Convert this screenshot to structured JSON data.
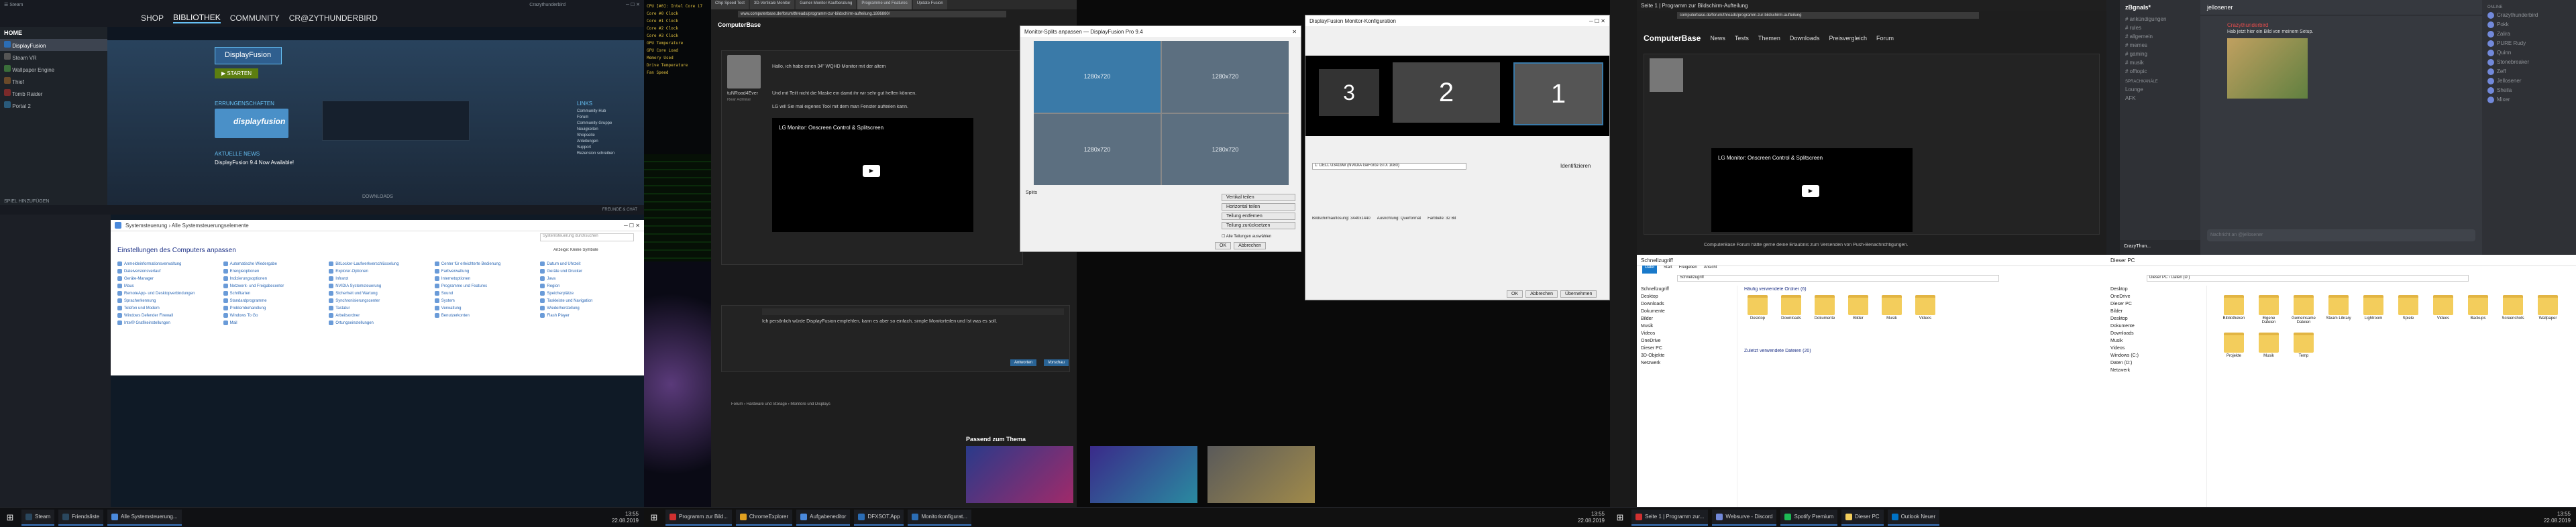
{
  "monitor1": {
    "steam": {
      "nav": [
        "SHOP",
        "BIBLIOTHEK",
        "COMMUNITY",
        "CR@ZYTHUNDERBIRD"
      ],
      "active_nav": "BIBLIOTHEK",
      "user_badge": "Crazythunderbird",
      "sidebar_header": "HOME",
      "sidebar_items": [
        "DisplayFusion",
        "Steam VR",
        "Wallpaper Engine",
        "Thief",
        "Tomb Raider",
        "Portal 2"
      ],
      "game_title": "DisplayFusion",
      "play_button": "▶ STARTEN",
      "achievements_label": "ERRUNGENSCHAFTEN",
      "achievement_banner": "displayfusion",
      "section_latest_news": "AKTUELLE NEWS",
      "news_title": "DisplayFusion 9.4 Now Available!",
      "links_header": "LINKS",
      "links": [
        "Community-Hub",
        "Forum",
        "Community-Gruppe",
        "Neuigkeiten",
        "Shopseite",
        "Anleitungen",
        "Support",
        "Rezension schreiben"
      ],
      "downloads_label": "DOWNLOADS",
      "downloads_status": "Verwalten",
      "friends_header": "FREUNDE & CHAT",
      "add_game": "SPIEL HINZUFÜGEN"
    },
    "control_panel": {
      "address": "Systemsteuerung › Alle Systemsteuerungselemente",
      "search_placeholder": "Systemsteuerung durchsuchen",
      "heading": "Einstellungen des Computers anpassen",
      "view_by": "Anzeige: Kleine Symbole",
      "items": [
        "Anmeldeinformationsverwaltung",
        "Automatische Wiedergabe",
        "BitLocker-Laufwerkverschlüsselung",
        "Center für erleichterte Bedienung",
        "Datum und Uhrzeit",
        "Dateiversionsverlauf",
        "Energieoptionen",
        "Explorer-Optionen",
        "Farbverwaltung",
        "Geräte und Drucker",
        "Geräte-Manager",
        "Indizierungsoptionen",
        "Infrarot",
        "Internetoptionen",
        "Java",
        "Maus",
        "Netzwerk- und Freigabecenter",
        "NVIDIA Systemsteuerung",
        "Programme und Features",
        "Region",
        "RemoteApp- und Desktopverbindungen",
        "Schriftarten",
        "Sicherheit und Wartung",
        "Sound",
        "Speicherplätze",
        "Spracherkennung",
        "Standardprogramme",
        "Synchronisierungscenter",
        "System",
        "Taskleiste und Navigation",
        "Telefon und Modem",
        "Problembehandlung",
        "Tastatur",
        "Verwaltung",
        "Wiederherstellung",
        "Windows Defender Firewall",
        "Windows To Go",
        "Arbeitsordner",
        "Benutzerkonten",
        "Flash Player",
        "Intel® Grafikeinstellungen",
        "Mail",
        "Ortungseinstellungen"
      ]
    },
    "taskbar": {
      "items": [
        "Steam",
        "Friendsliste",
        "Alle Systemsteuerung..."
      ],
      "time": "13:55",
      "date": "22.08.2019"
    }
  },
  "monitor2": {
    "hwinfo_lines": [
      "CPU [#0]: Intel Core i7",
      "Core #0 Clock",
      "Core #1 Clock",
      "Core #2 Clock",
      "Core #3 Clock",
      "GPU Temperature",
      "GPU Core Load",
      "Memory Used",
      "Drive Temperature",
      "Fan Speed"
    ],
    "browser_tabs": [
      "Chip Speed Test",
      "3D-Vertikale Monitor",
      "Gamer-Monitor Kaufberatung",
      "Programme und Features",
      "Update Fusion"
    ],
    "address": "www.computerbase.de/forum/threads/programm-zur-bildschirm-aufteilung.1886880/",
    "forum_logo": "ComputerBase",
    "user": "tuNRoad4Ever",
    "user_rank": "Rear Admiral",
    "post_text_1": "Hallo, ich habe einen 34\" WQHD Monitor mit der altem",
    "post_text_2": "Und mit Teilt nicht die Maske ein damit ihr wir sehr gut helfen können.",
    "post_text_3": "LG will Sie mal eigenes Tool mit dem man Fenster aufteilen kann.",
    "video_title": "LG Monitor: Onscreen Control & Splitscreen",
    "reply_placeholder": "Ich persönlich würde DisplayFusion empfehlen, kann es aber so einfach, simple Monitorteilen und Ist was es soll.",
    "reply_button": "Antworten",
    "preview_button": "Vorschau",
    "breadcrumb": "Forum › Hardware und Storage › Monitore und Displays",
    "related_header": "Passend zum Thema",
    "dialog": {
      "title": "Monitor-Splits anpassen — DisplayFusion Pro 9.4",
      "cells": [
        "1280x720",
        "1280x720",
        "1280x720",
        "1280x720"
      ],
      "split_label": "Splits",
      "buttons": [
        "Vertikal teilen",
        "Horizontal teilen",
        "Teilung entfernen",
        "Teilung zurücksetzen"
      ],
      "ok": "OK",
      "cancel": "Abbrechen",
      "apply": "Übernehmen",
      "checkbox": "Alle Teilungen auswählen"
    },
    "monitor_cfg": {
      "title": "DisplayFusion Monitor-Konfiguration",
      "numbers": [
        "3",
        "2",
        "1"
      ],
      "dropdown": "1: DELL U3419W (NVIDIA GeForce GTX 1080)",
      "labels": [
        "Bildschirmauflösung: 3440x1440",
        "Ausrichtung: Querformat",
        "Farbtiefe: 32 Bit"
      ],
      "identify": "Identifizieren",
      "ok": "OK",
      "cancel": "Abbrechen",
      "apply": "Übernehmen"
    },
    "taskbar_items": [
      "Programm zur Bild...",
      "ChromeExplorer",
      "Aufgabeneditor",
      "DFXSOT.App",
      "Monitorkonfigurat..."
    ],
    "time": "13:55",
    "date": "22.08.2019"
  },
  "monitor3": {
    "browser_title": "Seite 1 | Programm zur Bildschirm-Aufteilung",
    "address": "computerbase.de/forum/threads/programm-zur-bildschirm-aufteilung",
    "forum_nav": [
      "News",
      "Tests",
      "Themen",
      "Downloads",
      "Preisvergleich",
      "Forum"
    ],
    "video_title": "LG Monitor: Onscreen Control & Splitscreen",
    "footer_text": "ComputerBase Forum hätte gerne deine Erlaubnis zum Versenden von Push-Benachrichtigungen.",
    "discord": {
      "server": "zBgnals*",
      "channel_header": "jellosener",
      "channels": [
        "# ankündigungen",
        "# rules",
        "# allgemein",
        "# memes",
        "# gaming",
        "# musik",
        "# offtopic"
      ],
      "voice_header": "SPRACHKANÄLE",
      "voice": [
        "Lounge",
        "AFK"
      ],
      "user": "CrazyThun...",
      "message_author": "Crazythunderbird",
      "message_text": "Hab jetzt hier ein Bild von meinem Setup.",
      "input_placeholder": "Nachricht an @jellosener",
      "members_header": "ONLINE",
      "members": [
        "Crazythunderbird",
        "Pokk",
        "Zalira",
        "PURE Rudy",
        "Quinn",
        "Stonebreaker",
        "Zeff",
        "Jellosener",
        "Sheila",
        "Mixer"
      ]
    },
    "explorer_left": {
      "title": "Schnellzugriff",
      "ribbon": [
        "Datei",
        "Start",
        "Freigeben",
        "Ansicht"
      ],
      "address": "Schnellzugriff",
      "nav": [
        "Schnellzugriff",
        "Desktop",
        "Downloads",
        "Dokumente",
        "Bilder",
        "Musik",
        "Videos",
        "OneDrive",
        "Dieser PC",
        "3D-Objekte",
        "Netzwerk"
      ],
      "group_header": "Häufig verwendete Ordner (6)",
      "folders": [
        "Desktop",
        "Downloads",
        "Dokumente",
        "Bilder",
        "Musik",
        "Videos"
      ],
      "recent_header": "Zuletzt verwendete Dateien (20)"
    },
    "explorer_right": {
      "title": "Dieser PC",
      "address": "Dieser PC › Daten (D:)",
      "nav": [
        "Desktop",
        "OneDrive",
        "Dieser PC",
        "Bilder",
        "Desktop",
        "Dokumente",
        "Downloads",
        "Musik",
        "Videos",
        "Windows (C:)",
        "Daten (D:)",
        "Netzwerk"
      ],
      "folders": [
        "Bibliotheken",
        "Eigene Dateien",
        "Gemeinsame Dateien",
        "Steam Library",
        "Lightroom",
        "Spiele",
        "Videos",
        "Backups",
        "Screenshots",
        "Wallpaper",
        "Projekte",
        "Musik",
        "Temp"
      ]
    },
    "taskbar_items": [
      "Seite 1 | Programm zur...",
      "Websurve - Discord",
      "Spotify Premium",
      "Dieser PC",
      "Outlook Neuer"
    ],
    "time": "13:55",
    "date": "22.08.2019"
  },
  "colors": {
    "steam_bg": "#1b2838",
    "steam_accent": "#66c0f4",
    "forum_bg": "#1e1e1e",
    "discord_bg": "#36393f",
    "explorer_bg": "#ffffff",
    "taskbar": "#101114",
    "split_cell": "#5c6f80"
  }
}
